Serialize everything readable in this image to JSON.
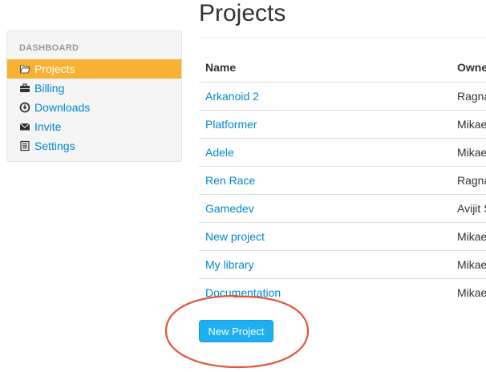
{
  "sidebar": {
    "header": "DASHBOARD",
    "items": [
      {
        "label": "Projects",
        "icon": "folder-open-icon",
        "active": true
      },
      {
        "label": "Billing",
        "icon": "briefcase-icon",
        "active": false
      },
      {
        "label": "Downloads",
        "icon": "download-circle-icon",
        "active": false
      },
      {
        "label": "Invite",
        "icon": "envelope-icon",
        "active": false
      },
      {
        "label": "Settings",
        "icon": "list-icon",
        "active": false
      }
    ]
  },
  "main": {
    "title": "Projects",
    "table": {
      "columns": [
        "Name",
        "Owne"
      ],
      "rows": [
        {
          "name": "Arkanoid 2",
          "owner": "Ragna"
        },
        {
          "name": "Platformer",
          "owner": "Mikae"
        },
        {
          "name": "Adele",
          "owner": "Mikae"
        },
        {
          "name": "Ren Race",
          "owner": "Ragna"
        },
        {
          "name": "Gamedev",
          "owner": "Avijit S"
        },
        {
          "name": "New project",
          "owner": "Mikae"
        },
        {
          "name": "My library",
          "owner": "Mikae"
        },
        {
          "name": "Documentation",
          "owner": "Mikae"
        }
      ]
    },
    "new_project_label": "New Project"
  },
  "colors": {
    "accent_active": "#f8b133",
    "link": "#0088cc",
    "button": "#1eaff0",
    "annotation": "#e0573a"
  }
}
